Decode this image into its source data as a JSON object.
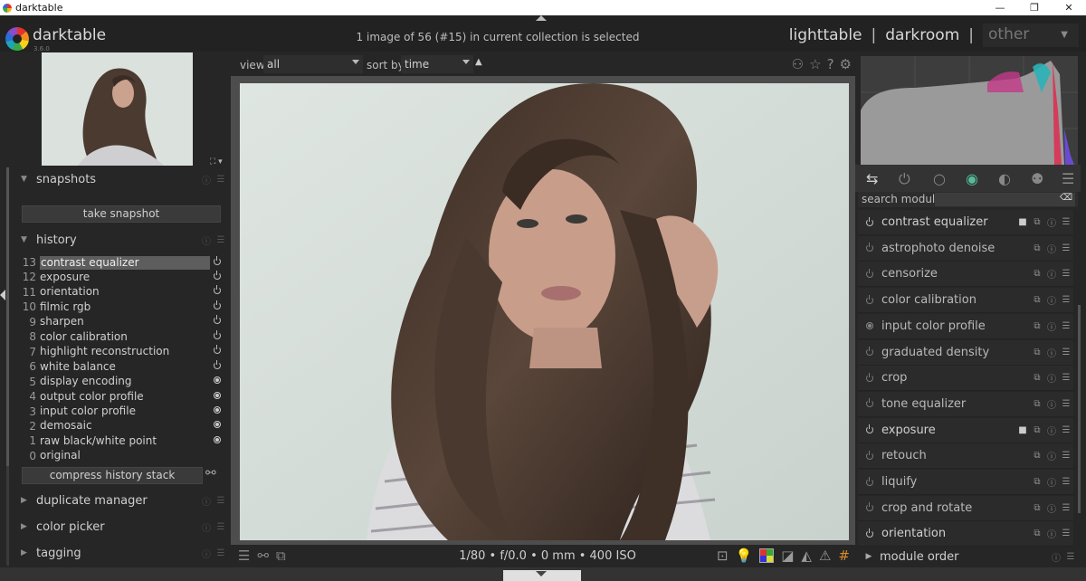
{
  "window": {
    "title": "darktable",
    "controls": [
      "—",
      "❐",
      "✕"
    ]
  },
  "header": {
    "logo_text": "darktable",
    "logo_version": "3.6.0",
    "collection_message": "1 image of 56 (#15) in current collection is selected",
    "views": {
      "lighttable": "lighttable",
      "separator": "|",
      "darkroom": "darkroom",
      "other": "other"
    }
  },
  "left": {
    "snapshots": {
      "title": "snapshots",
      "take_button": "take snapshot"
    },
    "history": {
      "title": "history",
      "items": [
        {
          "num": "13",
          "label": "contrast equalizer",
          "state": "power",
          "selected": true
        },
        {
          "num": "12",
          "label": "exposure",
          "state": "power"
        },
        {
          "num": "11",
          "label": "orientation",
          "state": "power"
        },
        {
          "num": "10",
          "label": "filmic rgb",
          "state": "power"
        },
        {
          "num": "9",
          "label": "sharpen",
          "state": "power"
        },
        {
          "num": "8",
          "label": "color calibration",
          "state": "power"
        },
        {
          "num": "7",
          "label": "highlight reconstruction",
          "state": "power"
        },
        {
          "num": "6",
          "label": "white balance",
          "state": "power"
        },
        {
          "num": "5",
          "label": "display encoding",
          "state": "always"
        },
        {
          "num": "4",
          "label": "output color profile",
          "state": "always"
        },
        {
          "num": "3",
          "label": "input color profile",
          "state": "always"
        },
        {
          "num": "2",
          "label": "demosaic",
          "state": "always"
        },
        {
          "num": "1",
          "label": "raw black/white point",
          "state": "always"
        },
        {
          "num": "0",
          "label": "original",
          "state": "none"
        }
      ],
      "compress_button": "compress history stack"
    },
    "duplicate_manager": "duplicate manager",
    "color_picker": "color picker",
    "tagging": "tagging"
  },
  "center": {
    "view_label": "view",
    "view_value": "all",
    "sort_label": "sort by",
    "sort_value": "time",
    "exif": "1/80 • f/0.0 • 0 mm • 400 ISO"
  },
  "right": {
    "search_label": "search module",
    "modules": [
      {
        "name": "contrast equalizer",
        "on": true,
        "mask": true
      },
      {
        "name": "astrophoto denoise",
        "on": false
      },
      {
        "name": "censorize",
        "on": false
      },
      {
        "name": "color calibration",
        "on": false
      },
      {
        "name": "input color profile",
        "on": false,
        "always": true
      },
      {
        "name": "graduated density",
        "on": false
      },
      {
        "name": "crop",
        "on": false
      },
      {
        "name": "tone equalizer",
        "on": false
      },
      {
        "name": "exposure",
        "on": true,
        "mask": true
      },
      {
        "name": "retouch",
        "on": false
      },
      {
        "name": "liquify",
        "on": false
      },
      {
        "name": "crop and rotate",
        "on": false
      },
      {
        "name": "orientation",
        "on": true
      }
    ],
    "module_order": "module order"
  }
}
